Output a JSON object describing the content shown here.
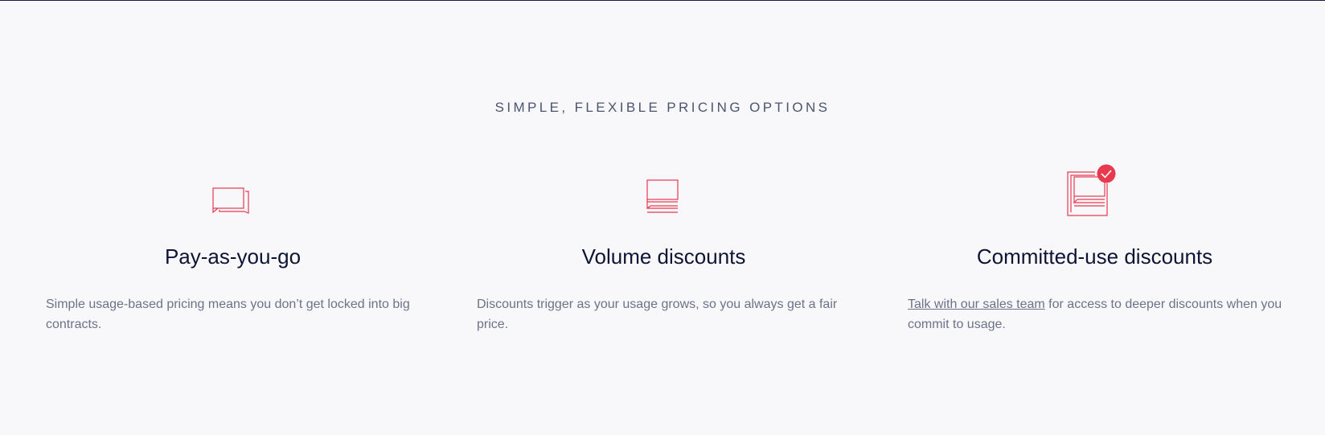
{
  "section": {
    "heading": "SIMPLE, FLEXIBLE PRICING OPTIONS"
  },
  "options": [
    {
      "icon": "chat-bubbles-icon",
      "title": "Pay-as-you-go",
      "description": "Simple usage-based pricing means you don’t get locked into big contracts."
    },
    {
      "icon": "stacked-messages-icon",
      "title": "Volume discounts",
      "description": "Discounts trigger as your usage grows, so you always get a fair price."
    },
    {
      "icon": "document-check-icon",
      "title": "Committed-use discounts",
      "link_text": "Talk with our sales team",
      "description_rest": " for access to deeper discounts when you commit to usage."
    }
  ],
  "colors": {
    "accent": "#e8394f",
    "heading": "#4b5570",
    "title": "#0e1433",
    "body": "#6c7389",
    "background": "#f8f8fa"
  }
}
